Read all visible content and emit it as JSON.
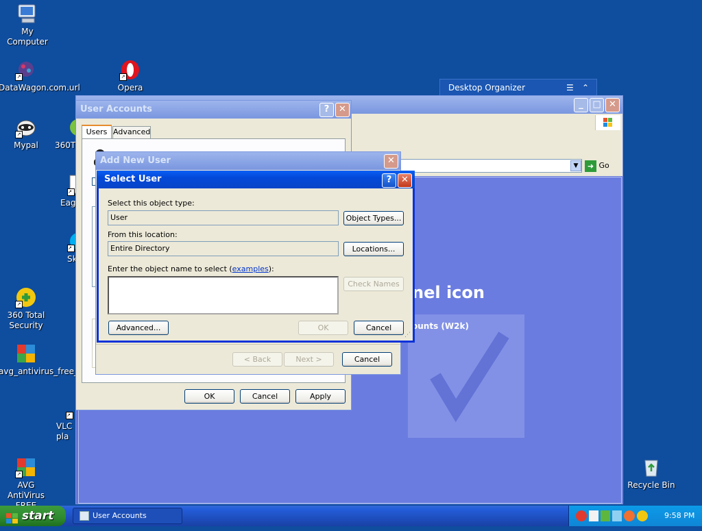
{
  "desktop": {
    "icons": [
      {
        "label": "My Computer"
      },
      {
        "label": "DataWagon.com.url"
      },
      {
        "label": "Opera"
      },
      {
        "label": "Mypal"
      },
      {
        "label": "360T"
      },
      {
        "label": "Eag"
      },
      {
        "label": "Sk"
      },
      {
        "label": "360 Total Security"
      },
      {
        "label": "avg_antivirus_free_setup"
      },
      {
        "label": "VLC pla"
      },
      {
        "label": "AVG AntiVirus FREE"
      },
      {
        "label": "Recycle Bin"
      }
    ]
  },
  "desktop_organizer": {
    "title": "Desktop Organizer"
  },
  "control_panel": {
    "go_label": "Go",
    "banner_text": "nel icon",
    "sub_text": "ounts (W2k)"
  },
  "user_accounts": {
    "title": "User Accounts",
    "tabs": [
      "Users",
      "Advanced"
    ],
    "ok_label": "OK",
    "cancel_label": "Cancel",
    "apply_label": "Apply"
  },
  "add_new_user": {
    "title": "Add New User",
    "back_label": "< Back",
    "next_label": "Next >",
    "cancel_label": "Cancel"
  },
  "select_user": {
    "title": "Select User",
    "object_type_label": "Select this object type:",
    "object_type_value": "User",
    "object_types_button": "Object Types...",
    "location_label": "From this location:",
    "location_value": "Entire Directory",
    "locations_button": "Locations...",
    "enter_name_label": "Enter the object name to select (",
    "examples_link": "examples",
    "enter_name_suffix": "):",
    "object_name_value": "",
    "check_names_button": "Check Names",
    "advanced_button": "Advanced...",
    "ok_button": "OK",
    "cancel_button": "Cancel"
  },
  "taskbar": {
    "start_label": "start",
    "tasks": [
      {
        "label": "User Accounts"
      }
    ],
    "clock": "9:58 PM"
  }
}
